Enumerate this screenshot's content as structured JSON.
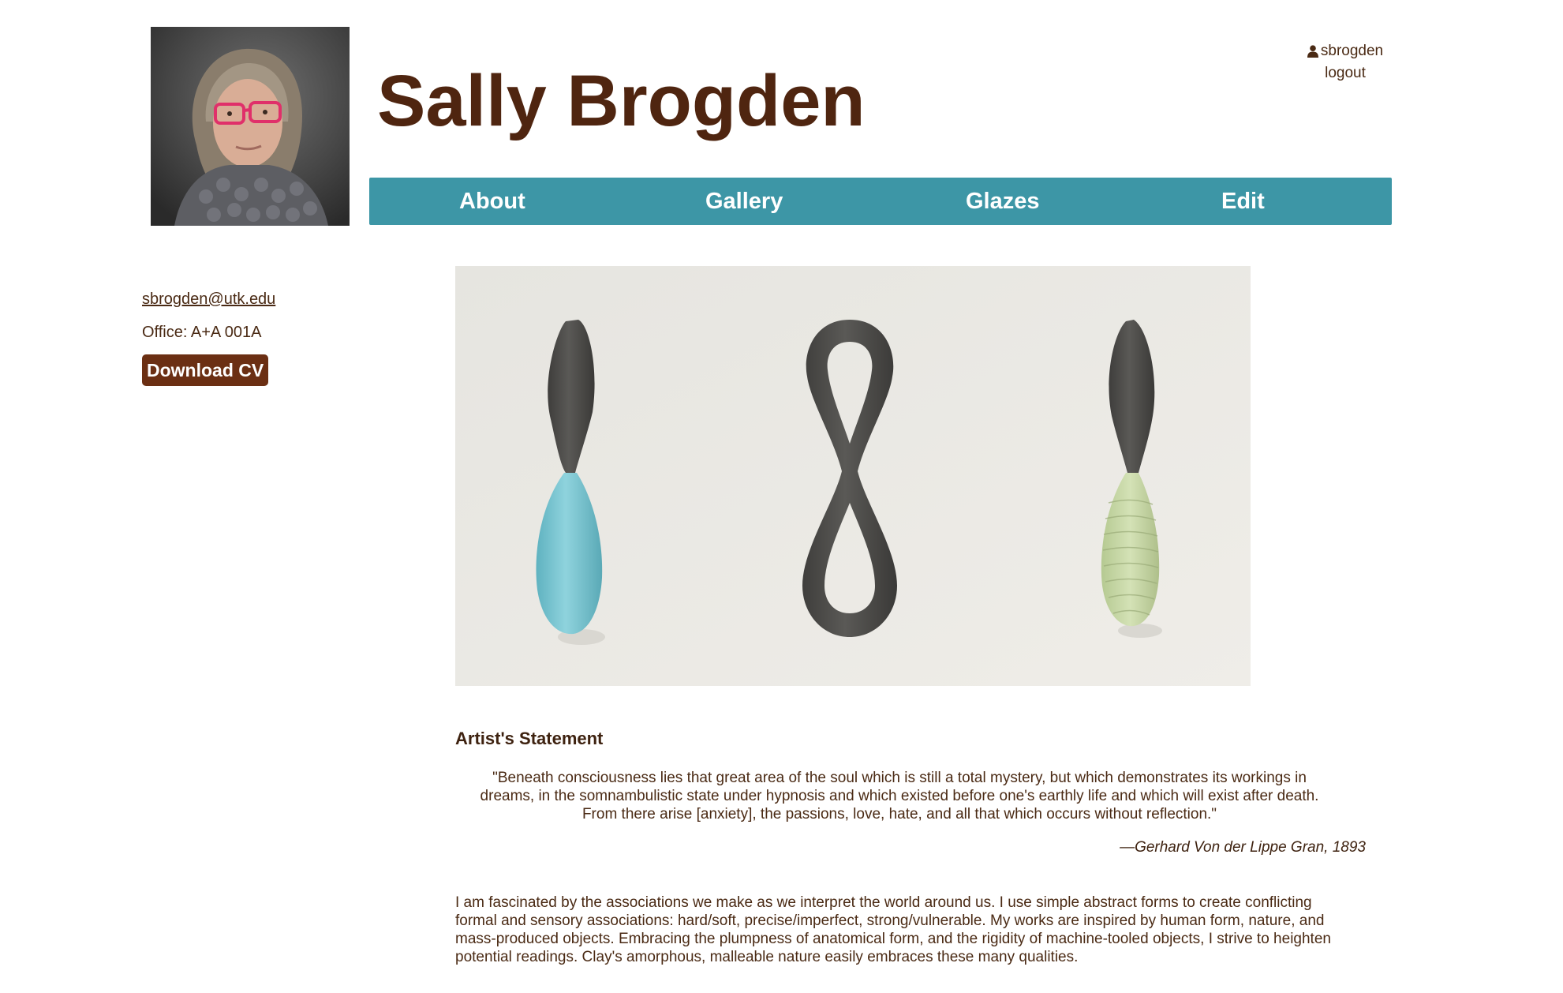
{
  "header": {
    "title": "Sally Brogden"
  },
  "user": {
    "username": "sbrogden",
    "logout_label": "logout"
  },
  "nav": {
    "about": "About",
    "gallery": "Gallery",
    "glazes": "Glazes",
    "edit": "Edit"
  },
  "sidebar": {
    "email": "sbrogden@utk.edu",
    "office": "Office: A+A 001A",
    "cv_button": "Download CV"
  },
  "statement": {
    "heading": "Artist's Statement",
    "quote": "\"Beneath consciousness lies that great area of the soul which is still a total mystery, but which demonstrates its workings in dreams, in the somnambulistic state under hypnosis and which existed before one's earthly life and which will exist after death. From there arise [anxiety], the passions, love, hate, and all that which occurs without reflection.\"",
    "attribution": "—Gerhard Von der Lippe Gran, 1893",
    "body": "I am fascinated by the associations we make as we interpret the world around us. I use simple abstract forms to create conflicting formal and sensory associations: hard/soft, precise/imperfect, strong/vulnerable. My works are inspired by human form, nature, and mass-produced objects. Embracing the plumpness of anatomical form, and the rigidity of machine-tooled objects, I strive to heighten potential readings. Clay's amorphous, malleable nature easily embraces these many qualities."
  },
  "colors": {
    "title": "#4f2510",
    "text": "#4a2a14",
    "nav_bg": "#3d96a6",
    "nav_text": "#ffffff",
    "cv_button_bg": "#6b2f13",
    "sculpture_dark": "#4b4a48",
    "glaze_blue": "#7cc6d1",
    "glaze_green": "#c8d8a8"
  },
  "icons": {
    "user": "user-icon"
  }
}
